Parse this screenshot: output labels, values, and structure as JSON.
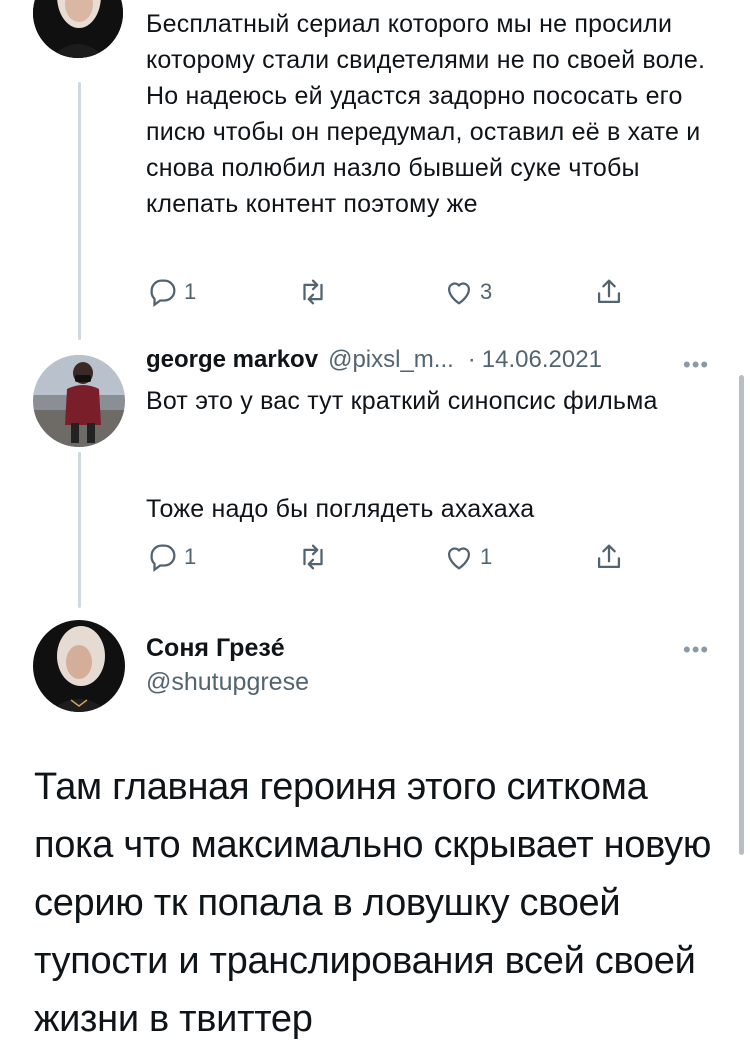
{
  "tweet1": {
    "text": "Бесплатный сериал которого мы не просили которому стали свидетелями не по своей воле. Но надеюсь ей удастся задорно пососать его писю чтобы он передумал, оставил её в хате и снова полюбил назло бывшей суке чтобы клепать контент поэтому же",
    "reply_count": "1",
    "retweet_count": "",
    "like_count": "3"
  },
  "tweet2": {
    "name": "george markov",
    "handle": "@pixsl_m...",
    "separator": "·",
    "date": "14.06.2021",
    "text_line1": "Вот это у вас тут краткий синопсис фильма",
    "text_line2": "Тоже надо бы поглядеть ахахаха",
    "reply_count": "1",
    "retweet_count": "",
    "like_count": "1"
  },
  "main_tweet": {
    "name": "Соня Грезé",
    "handle": "@shutupgrese",
    "text": "Там главная героиня этого ситкома пока что максимально скрывает новую серию тк попала в ловушку своей тупости и транслирования всей своей жизни в твиттер"
  },
  "icons": {
    "reply": "reply-icon",
    "retweet": "retweet-icon",
    "like": "heart-icon",
    "share": "share-icon",
    "more": "more-icon"
  },
  "colors": {
    "text": "#0f1419",
    "secondary": "#536471",
    "thread_line": "#cfd9de"
  },
  "more_glyph": "•••"
}
